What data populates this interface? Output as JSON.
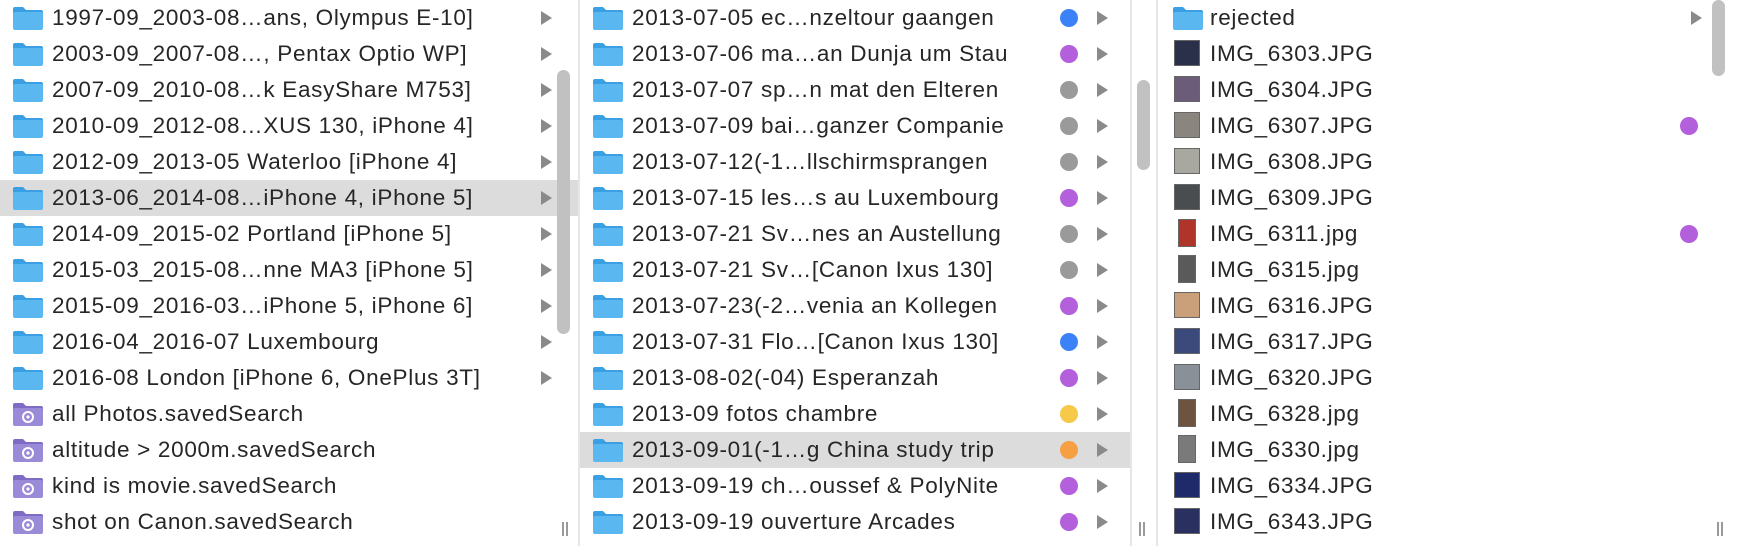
{
  "colors": {
    "folder": "#5ab7f0",
    "folder_dark": "#3a9fe3",
    "smart_folder": "#9b8ad8",
    "tag_blue": "#3b82f6",
    "tag_purple": "#b45fdb",
    "tag_gray": "#9a9a9a",
    "tag_yellow": "#f7c948",
    "tag_orange": "#f5a043"
  },
  "column1": {
    "items": [
      {
        "name": "1997-09_2003-08…ans, Olympus E-10]",
        "icon": "folder-icon",
        "arrow": true
      },
      {
        "name": "2003-09_2007-08…, Pentax Optio WP]",
        "icon": "folder-icon",
        "arrow": true
      },
      {
        "name": "2007-09_2010-08…k EasyShare M753]",
        "icon": "folder-icon",
        "arrow": true
      },
      {
        "name": "2010-09_2012-08…XUS 130, iPhone 4]",
        "icon": "folder-icon",
        "arrow": true
      },
      {
        "name": "2012-09_2013-05 Waterloo [iPhone 4]",
        "icon": "folder-icon",
        "arrow": true
      },
      {
        "name": "2013-06_2014-08…iPhone 4, iPhone 5]",
        "icon": "folder-icon",
        "arrow": true,
        "selected": true
      },
      {
        "name": "2014-09_2015-02 Portland [iPhone 5]",
        "icon": "folder-icon",
        "arrow": true
      },
      {
        "name": "2015-03_2015-08…nne MA3 [iPhone 5]",
        "icon": "folder-icon",
        "arrow": true
      },
      {
        "name": "2015-09_2016-03…iPhone 5, iPhone 6]",
        "icon": "folder-icon",
        "arrow": true
      },
      {
        "name": "2016-04_2016-07 Luxembourg",
        "icon": "folder-icon",
        "arrow": true
      },
      {
        "name": "2016-08 London [iPhone 6, OnePlus 3T]",
        "icon": "folder-icon",
        "arrow": true
      },
      {
        "name": "all Photos.savedSearch",
        "icon": "smart-folder-icon",
        "arrow": false
      },
      {
        "name": "altitude > 2000m.savedSearch",
        "icon": "smart-folder-icon",
        "arrow": false
      },
      {
        "name": "kind is movie.savedSearch",
        "icon": "smart-folder-icon",
        "arrow": false
      },
      {
        "name": "shot on Canon.savedSearch",
        "icon": "smart-folder-icon",
        "arrow": false
      }
    ]
  },
  "column2": {
    "items": [
      {
        "name": "2013-07-05 ec…nzeltour gaangen",
        "tag": "tag_blue"
      },
      {
        "name": "2013-07-06 ma…an Dunja um Stau",
        "tag": "tag_purple"
      },
      {
        "name": "2013-07-07 sp…n mat den Elteren",
        "tag": "tag_gray"
      },
      {
        "name": "2013-07-09 bai…ganzer Companie",
        "tag": "tag_gray"
      },
      {
        "name": "2013-07-12(-1…llschirmsprangen",
        "tag": "tag_gray"
      },
      {
        "name": "2013-07-15 les…s au Luxembourg",
        "tag": "tag_purple"
      },
      {
        "name": "2013-07-21 Sv…nes an Austellung",
        "tag": "tag_gray"
      },
      {
        "name": "2013-07-21 Sv…[Canon Ixus 130]",
        "tag": "tag_gray"
      },
      {
        "name": "2013-07-23(-2…venia an Kollegen",
        "tag": "tag_purple"
      },
      {
        "name": "2013-07-31 Flo…[Canon Ixus 130]",
        "tag": "tag_blue"
      },
      {
        "name": "2013-08-02(-04) Esperanzah",
        "tag": "tag_purple"
      },
      {
        "name": "2013-09 fotos chambre",
        "tag": "tag_yellow"
      },
      {
        "name": "2013-09-01(-1…g China study trip",
        "tag": "tag_orange",
        "selected": true
      },
      {
        "name": "2013-09-19 ch…oussef & PolyNite",
        "tag": "tag_purple"
      },
      {
        "name": "2013-09-19 ouverture Arcades",
        "tag": "tag_purple"
      }
    ]
  },
  "column3": {
    "items": [
      {
        "name": "rejected",
        "icon": "folder-icon",
        "arrow": true
      },
      {
        "name": "IMG_6303.JPG",
        "icon": "image-thumbnail-icon",
        "thumb": "#2a2f4a"
      },
      {
        "name": "IMG_6304.JPG",
        "icon": "image-thumbnail-icon",
        "thumb": "#6b5d7a"
      },
      {
        "name": "IMG_6307.JPG",
        "icon": "image-thumbnail-icon",
        "thumb": "#8b8580",
        "tag": "tag_purple"
      },
      {
        "name": "IMG_6308.JPG",
        "icon": "image-thumbnail-icon",
        "thumb": "#a8a8a0"
      },
      {
        "name": "IMG_6309.JPG",
        "icon": "image-thumbnail-icon",
        "thumb": "#4a4d50"
      },
      {
        "name": "IMG_6311.jpg",
        "icon": "image-thumbnail-icon",
        "thumb": "#b0342a",
        "portrait": true,
        "tag": "tag_purple"
      },
      {
        "name": "IMG_6315.jpg",
        "icon": "image-thumbnail-icon",
        "thumb": "#5a5a5a",
        "portrait": true
      },
      {
        "name": "IMG_6316.JPG",
        "icon": "image-thumbnail-icon",
        "thumb": "#c9a07a"
      },
      {
        "name": "IMG_6317.JPG",
        "icon": "image-thumbnail-icon",
        "thumb": "#3b4a7a"
      },
      {
        "name": "IMG_6320.JPG",
        "icon": "image-thumbnail-icon",
        "thumb": "#8a9098"
      },
      {
        "name": "IMG_6328.jpg",
        "icon": "image-thumbnail-icon",
        "thumb": "#6e5440",
        "portrait": true
      },
      {
        "name": "IMG_6330.jpg",
        "icon": "image-thumbnail-icon",
        "thumb": "#7a7a7a",
        "portrait": true
      },
      {
        "name": "IMG_6334.JPG",
        "icon": "image-thumbnail-icon",
        "thumb": "#1e2a6a"
      },
      {
        "name": "IMG_6343.JPG",
        "icon": "image-thumbnail-icon",
        "thumb": "#2a3060"
      }
    ]
  }
}
